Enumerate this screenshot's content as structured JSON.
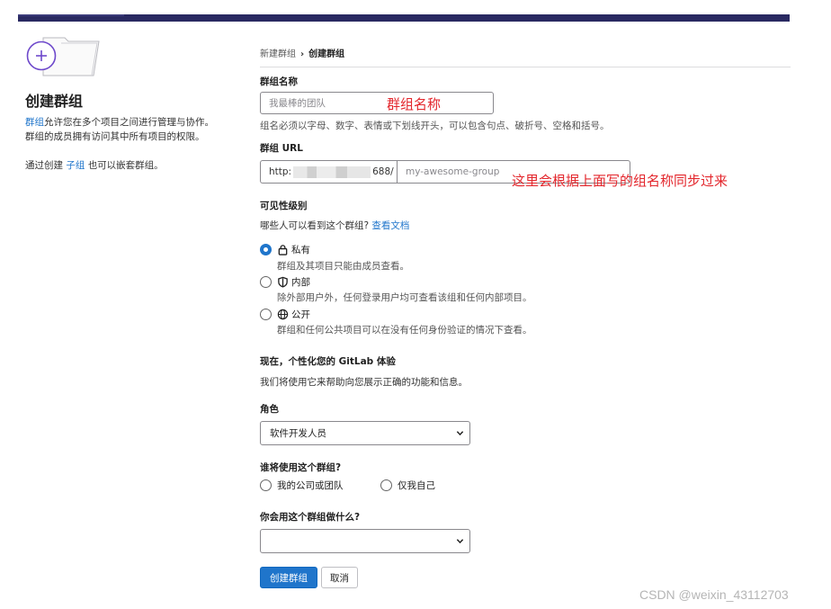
{
  "sidebar": {
    "title": "创建群组",
    "desc_link": "群组",
    "desc_1": "允许您在多个项目之间进行管理与协作。",
    "desc_2": "群组的成员拥有访问其中所有项目的权限。",
    "nest_pre": "通过创建",
    "nest_link": "子组",
    "nest_post": "也可以嵌套群组。"
  },
  "breadcrumb": {
    "parent": "新建群组",
    "current": "创建群组"
  },
  "form": {
    "name_label": "群组名称",
    "name_placeholder": "我最棒的团队",
    "name_help": "组名必须以字母、数字、表情或下划线开头，可以包含句点、破折号、空格和括号。",
    "url_label": "群组 URL",
    "url_prefix_start": "http:",
    "url_prefix_end": "688/",
    "url_slug_placeholder": "my-awesome-group",
    "visibility_label": "可见性级别",
    "visibility_question": "哪些人可以看到这个群组?",
    "visibility_docs": "查看文档",
    "visibility_options": [
      {
        "label": "私有",
        "desc": "群组及其项目只能由成员查看。",
        "icon": "lock-icon",
        "checked": true
      },
      {
        "label": "内部",
        "desc": "除外部用户外，任何登录用户均可查看该组和任何内部项目。",
        "icon": "shield-icon",
        "checked": false
      },
      {
        "label": "公开",
        "desc": "群组和任何公共项目可以在没有任何身份验证的情况下查看。",
        "icon": "globe-icon",
        "checked": false
      }
    ],
    "personalize_title": "现在，个性化您的 GitLab 体验",
    "personalize_desc": "我们将使用它来帮助向您展示正确的功能和信息。",
    "role_label": "角色",
    "role_value": "软件开发人员",
    "who_label": "谁将使用这个群组?",
    "who_options": [
      "我的公司或团队",
      "仅我自己"
    ],
    "what_label": "你会用这个群组做什么?",
    "what_value": "",
    "create_button": "创建群组",
    "cancel_button": "取消"
  },
  "annotations": {
    "name": "群组名称",
    "url": "这里会根据上面写的组名称同步过来"
  },
  "watermark": "CSDN @weixin_43112703",
  "colors": {
    "accent": "#1f75cb",
    "annotation": "#e3262c",
    "topbar": "#292961"
  }
}
